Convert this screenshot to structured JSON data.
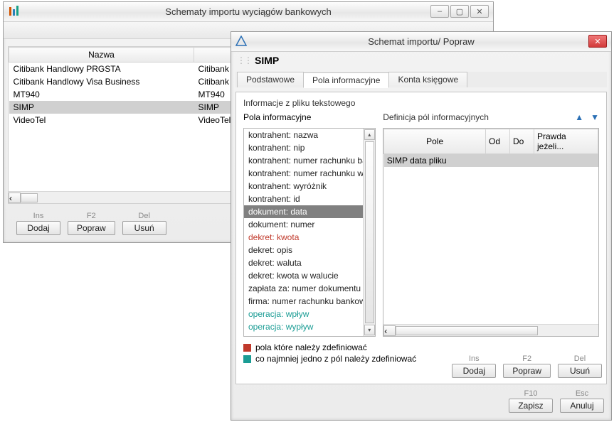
{
  "win1": {
    "title": "Schematy importu wyciągów bankowych",
    "col1": "Nazwa",
    "rows": [
      {
        "c0": "Citibank Handlowy PRGSTA",
        "c1": "Citibank Han"
      },
      {
        "c0": "Citibank Handlowy Visa Business",
        "c1": "Citibank Han"
      },
      {
        "c0": "MT940",
        "c1": "MT940"
      },
      {
        "c0": "SIMP",
        "c1": "SIMP",
        "sel": true
      },
      {
        "c0": "VideoTel",
        "c1": "VideoTel"
      }
    ],
    "hints": {
      "ins": "Ins",
      "f2": "F2",
      "del": "Del"
    },
    "buttons": {
      "add": "Dodaj",
      "edit": "Popraw",
      "del": "Usuń"
    }
  },
  "win2": {
    "title": "Schemat importu/ Popraw",
    "scheme": "SIMP",
    "tabs": [
      "Podstawowe",
      "Pola informacyjne",
      "Konta księgowe"
    ],
    "active_tab": 1,
    "group_title": "Informacje z pliku tekstowego",
    "list_title": "Pola informacyjne",
    "list": [
      {
        "t": "kontrahent: nazwa"
      },
      {
        "t": "kontrahent: nip"
      },
      {
        "t": "kontrahent: numer rachunku bankow"
      },
      {
        "t": "kontrahent: numer rachunku wirtualne"
      },
      {
        "t": "kontrahent: wyróżnik"
      },
      {
        "t": "kontrahent: id"
      },
      {
        "t": "dokument: data",
        "sel": true
      },
      {
        "t": "dokument: numer"
      },
      {
        "t": "dekret: kwota",
        "cls": "red"
      },
      {
        "t": "dekret: opis"
      },
      {
        "t": "dekret: waluta"
      },
      {
        "t": "dekret: kwota w walucie"
      },
      {
        "t": "zapłata za: numer dokumentu"
      },
      {
        "t": "firma: numer rachunku bankowego"
      },
      {
        "t": "operacja: wpływ",
        "cls": "teal"
      },
      {
        "t": "operacja: wypływ",
        "cls": "teal"
      }
    ],
    "def_title": "Definicja pól informacyjnych",
    "def_cols": [
      "Pole",
      "Od",
      "Do",
      "Prawda jeżeli..."
    ],
    "def_rows": [
      {
        "c0": "SIMP data pliku",
        "c1": "",
        "c2": "",
        "c3": "",
        "sel": true
      }
    ],
    "legend": {
      "red": "pola które należy zdefiniować",
      "teal": "co najmniej jedno z pól należy zdefiniować"
    },
    "hints": {
      "ins": "Ins",
      "f2": "F2",
      "del": "Del",
      "f10": "F10",
      "esc": "Esc"
    },
    "buttons": {
      "add": "Dodaj",
      "edit": "Popraw",
      "del": "Usuń",
      "save": "Zapisz",
      "cancel": "Anuluj"
    }
  }
}
